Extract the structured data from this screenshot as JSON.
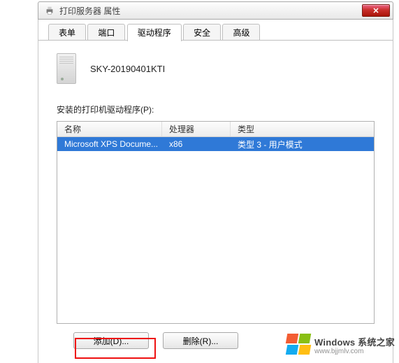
{
  "window": {
    "title": "打印服务器 属性",
    "close_glyph": "✕"
  },
  "tabs": {
    "items": [
      {
        "label": "表单"
      },
      {
        "label": "端口"
      },
      {
        "label": "驱动程序"
      },
      {
        "label": "安全"
      },
      {
        "label": "高级"
      }
    ]
  },
  "server_name": "SKY-20190401KTI",
  "section_label": "安装的打印机驱动程序(P):",
  "list": {
    "headers": {
      "name": "名称",
      "processor": "处理器",
      "type": "类型"
    },
    "rows": [
      {
        "name": "Microsoft XPS Docume...",
        "processor": "x86",
        "type": "类型 3 - 用户模式"
      }
    ]
  },
  "buttons": {
    "add": "添加(D)...",
    "remove": "删除(R)..."
  },
  "watermark": {
    "brand_prefix": "Windows",
    "brand_suffix": " 系统之家",
    "url": "www.bjjmlv.com"
  }
}
